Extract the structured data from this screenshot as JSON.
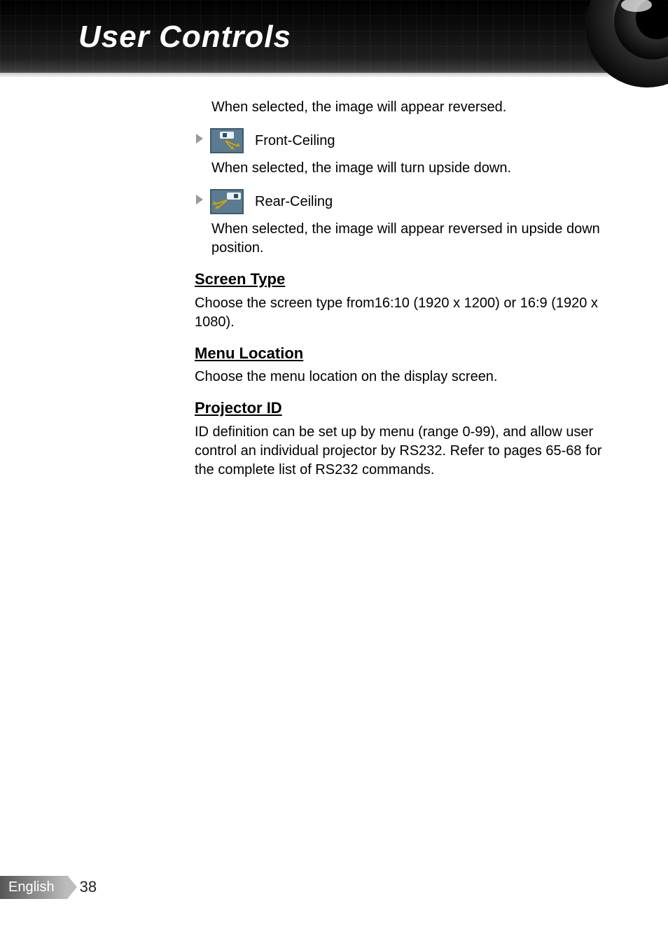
{
  "header": {
    "title": "User Controls"
  },
  "content": {
    "reversed_intro": "When selected, the image will appear reversed.",
    "front_ceiling_label": "Front-Ceiling",
    "front_ceiling_desc": "When selected, the image will turn upside down.",
    "rear_ceiling_label": "Rear-Ceiling",
    "rear_ceiling_desc": "When selected, the image will appear reversed in upside down position.",
    "screen_type_heading": "Screen Type",
    "screen_type_desc": "Choose the screen type from16:10 (1920 x 1200) or 16:9 (1920 x 1080).",
    "menu_location_heading": "Menu Location",
    "menu_location_desc": "Choose the menu location on the display screen.",
    "projector_id_heading": "Projector ID",
    "projector_id_desc": "ID definition can be set up by menu (range 0-99), and allow user control an individual projector by RS232. Refer to pages 65-68 for the complete list of RS232 commands."
  },
  "footer": {
    "language": "English",
    "page_number": "38"
  },
  "icons": {
    "front_ceiling": "front-ceiling-projection-icon",
    "rear_ceiling": "rear-ceiling-projection-icon"
  }
}
